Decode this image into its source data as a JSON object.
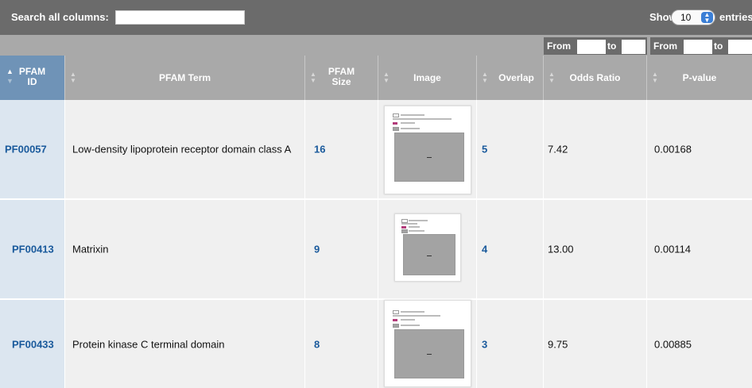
{
  "search": {
    "label": "Search all columns:",
    "value": ""
  },
  "length": {
    "show_label": "Show",
    "selected": "10",
    "entries_label": "entries"
  },
  "filters": {
    "from_label": "From",
    "to_label": "to"
  },
  "columns": [
    {
      "label_line1": "PFAM",
      "label_line2": "ID"
    },
    {
      "label": "PFAM Term"
    },
    {
      "label_line1": "PFAM",
      "label_line2": "Size"
    },
    {
      "label": "Image"
    },
    {
      "label": "Overlap"
    },
    {
      "label": "Odds Ratio"
    },
    {
      "label": "P-value"
    }
  ],
  "rows": [
    {
      "pfam_id": "PF00057",
      "term": "Low-density lipoprotein receptor domain class A",
      "size": "16",
      "overlap": "5",
      "odds_ratio": "7.42",
      "p_value": "0.00168"
    },
    {
      "pfam_id": "PF00413",
      "term": "Matrixin",
      "size": "9",
      "overlap": "4",
      "odds_ratio": "13.00",
      "p_value": "0.00114"
    },
    {
      "pfam_id": "PF00433",
      "term": "Protein kinase C terminal domain",
      "size": "8",
      "overlap": "3",
      "odds_ratio": "9.75",
      "p_value": "0.00885"
    }
  ],
  "colors": {
    "link": "#1a5a9c",
    "header": "#a9a9a9",
    "sorted_header": "#6f93b7",
    "toolbar": "#6b6b6b",
    "overlap_legend": "#b33b7a"
  }
}
